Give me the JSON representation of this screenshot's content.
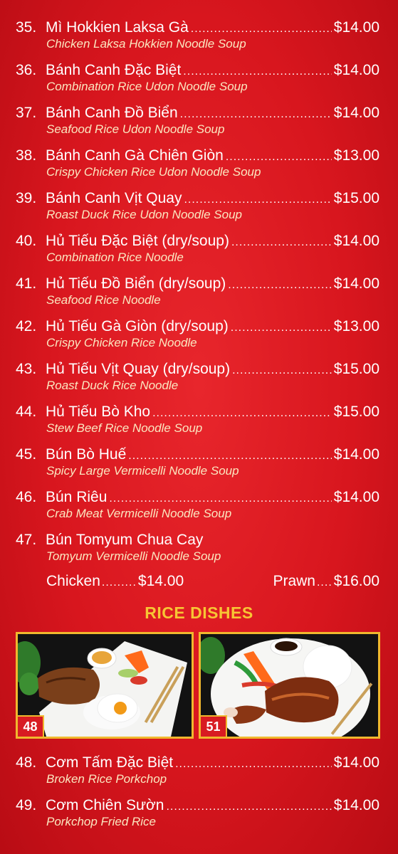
{
  "items": [
    {
      "num": "35.",
      "name": "Mì Hokkien Laksa Gà",
      "price": "$14.00",
      "desc": "Chicken Laksa Hokkien Noodle Soup"
    },
    {
      "num": "36.",
      "name": "Bánh Canh Đặc Biệt",
      "price": "$14.00",
      "desc": "Combination Rice Udon Noodle Soup"
    },
    {
      "num": "37.",
      "name": "Bánh Canh Đồ Biển",
      "price": "$14.00",
      "desc": "Seafood Rice Udon Noodle Soup"
    },
    {
      "num": "38.",
      "name": "Bánh Canh Gà Chiên Giòn",
      "price": "$13.00",
      "desc": "Crispy Chicken Rice Udon Noodle Soup"
    },
    {
      "num": "39.",
      "name": "Bánh Canh Vịt Quay",
      "price": "$15.00",
      "desc": "Roast Duck Rice Udon Noodle Soup"
    },
    {
      "num": "40.",
      "name": "Hủ Tiếu Đặc Biệt (dry/soup)",
      "price": "$14.00",
      "desc": "Combination Rice Noodle"
    },
    {
      "num": "41.",
      "name": "Hủ Tiếu Đồ Biển (dry/soup)",
      "price": "$14.00",
      "desc": "Seafood Rice Noodle"
    },
    {
      "num": "42.",
      "name": "Hủ Tiếu Gà Giòn (dry/soup)",
      "price": "$13.00",
      "desc": "Crispy Chicken Rice Noodle"
    },
    {
      "num": "43.",
      "name": "Hủ Tiếu Vịt Quay (dry/soup)",
      "price": "$15.00",
      "desc": "Roast Duck Rice Noodle"
    },
    {
      "num": "44.",
      "name": "Hủ Tiếu Bò Kho",
      "price": "$15.00",
      "desc": "Stew Beef Rice Noodle Soup"
    },
    {
      "num": "45.",
      "name": "Bún Bò Huế",
      "price": "$14.00",
      "desc": "Spicy Large Vermicelli Noodle Soup"
    },
    {
      "num": "46.",
      "name": "Bún Riêu",
      "price": "$14.00",
      "desc": "Crab Meat Vermicelli Noodle Soup"
    },
    {
      "num": "47.",
      "name": "Bún Tomyum Chua Cay",
      "price": "",
      "desc": "Tomyum Vermicelli Noodle Soup"
    }
  ],
  "item47_variants": {
    "chicken_label": "Chicken",
    "chicken_price": "$14.00",
    "prawn_label": "Prawn",
    "prawn_price": "$16.00"
  },
  "rice_section": {
    "title": "RICE DISHES",
    "photos": [
      {
        "badge": "48"
      },
      {
        "badge": "51"
      }
    ],
    "items": [
      {
        "num": "48.",
        "name": "Cơm Tấm Đặc Biệt",
        "price": "$14.00",
        "desc": "Broken Rice Porkchop"
      },
      {
        "num": "49.",
        "name": "Cơm Chiên Sườn",
        "price": "$14.00",
        "desc": "Porkchop Fried Rice"
      }
    ]
  },
  "colors": {
    "background": "#d8161e",
    "section_title": "#f7c534",
    "description": "#fbe7c0",
    "photo_border": "#f0b82e"
  }
}
